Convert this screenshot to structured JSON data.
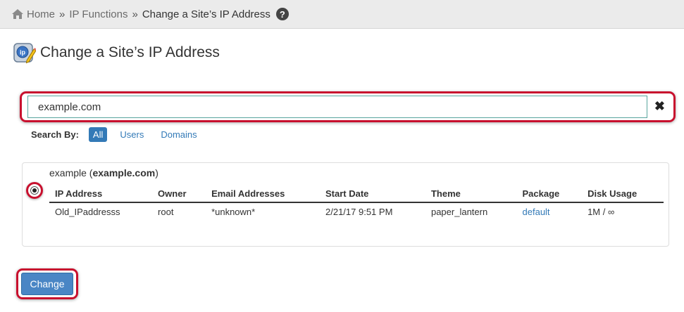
{
  "breadcrumb": {
    "home": "Home",
    "sep1": "»",
    "ip_functions": "IP Functions",
    "sep2": "»",
    "current": "Change a Site’s IP Address",
    "help": "?"
  },
  "page": {
    "title": "Change a Site’s IP Address",
    "title_icon": "ip-pencil-icon"
  },
  "search": {
    "value": "example.com",
    "clear": "✖"
  },
  "search_by": {
    "label": "Search By:",
    "options": [
      "All",
      "Users",
      "Domains"
    ],
    "selected": "All"
  },
  "result": {
    "name": "example",
    "domain": "example.com",
    "columns": [
      "IP Address",
      "Owner",
      "Email Addresses",
      "Start Date",
      "Theme",
      "Package",
      "Disk Usage"
    ],
    "row": [
      "Old_IPaddresss",
      "root",
      "*unknown*",
      "2/21/17 9:51 PM",
      "paper_lantern",
      "default",
      "1M / ∞"
    ]
  },
  "actions": {
    "change_label": "Change"
  },
  "colors": {
    "accent": "#337ab7",
    "highlight": "#c8102e",
    "button": "#4a86c5"
  }
}
